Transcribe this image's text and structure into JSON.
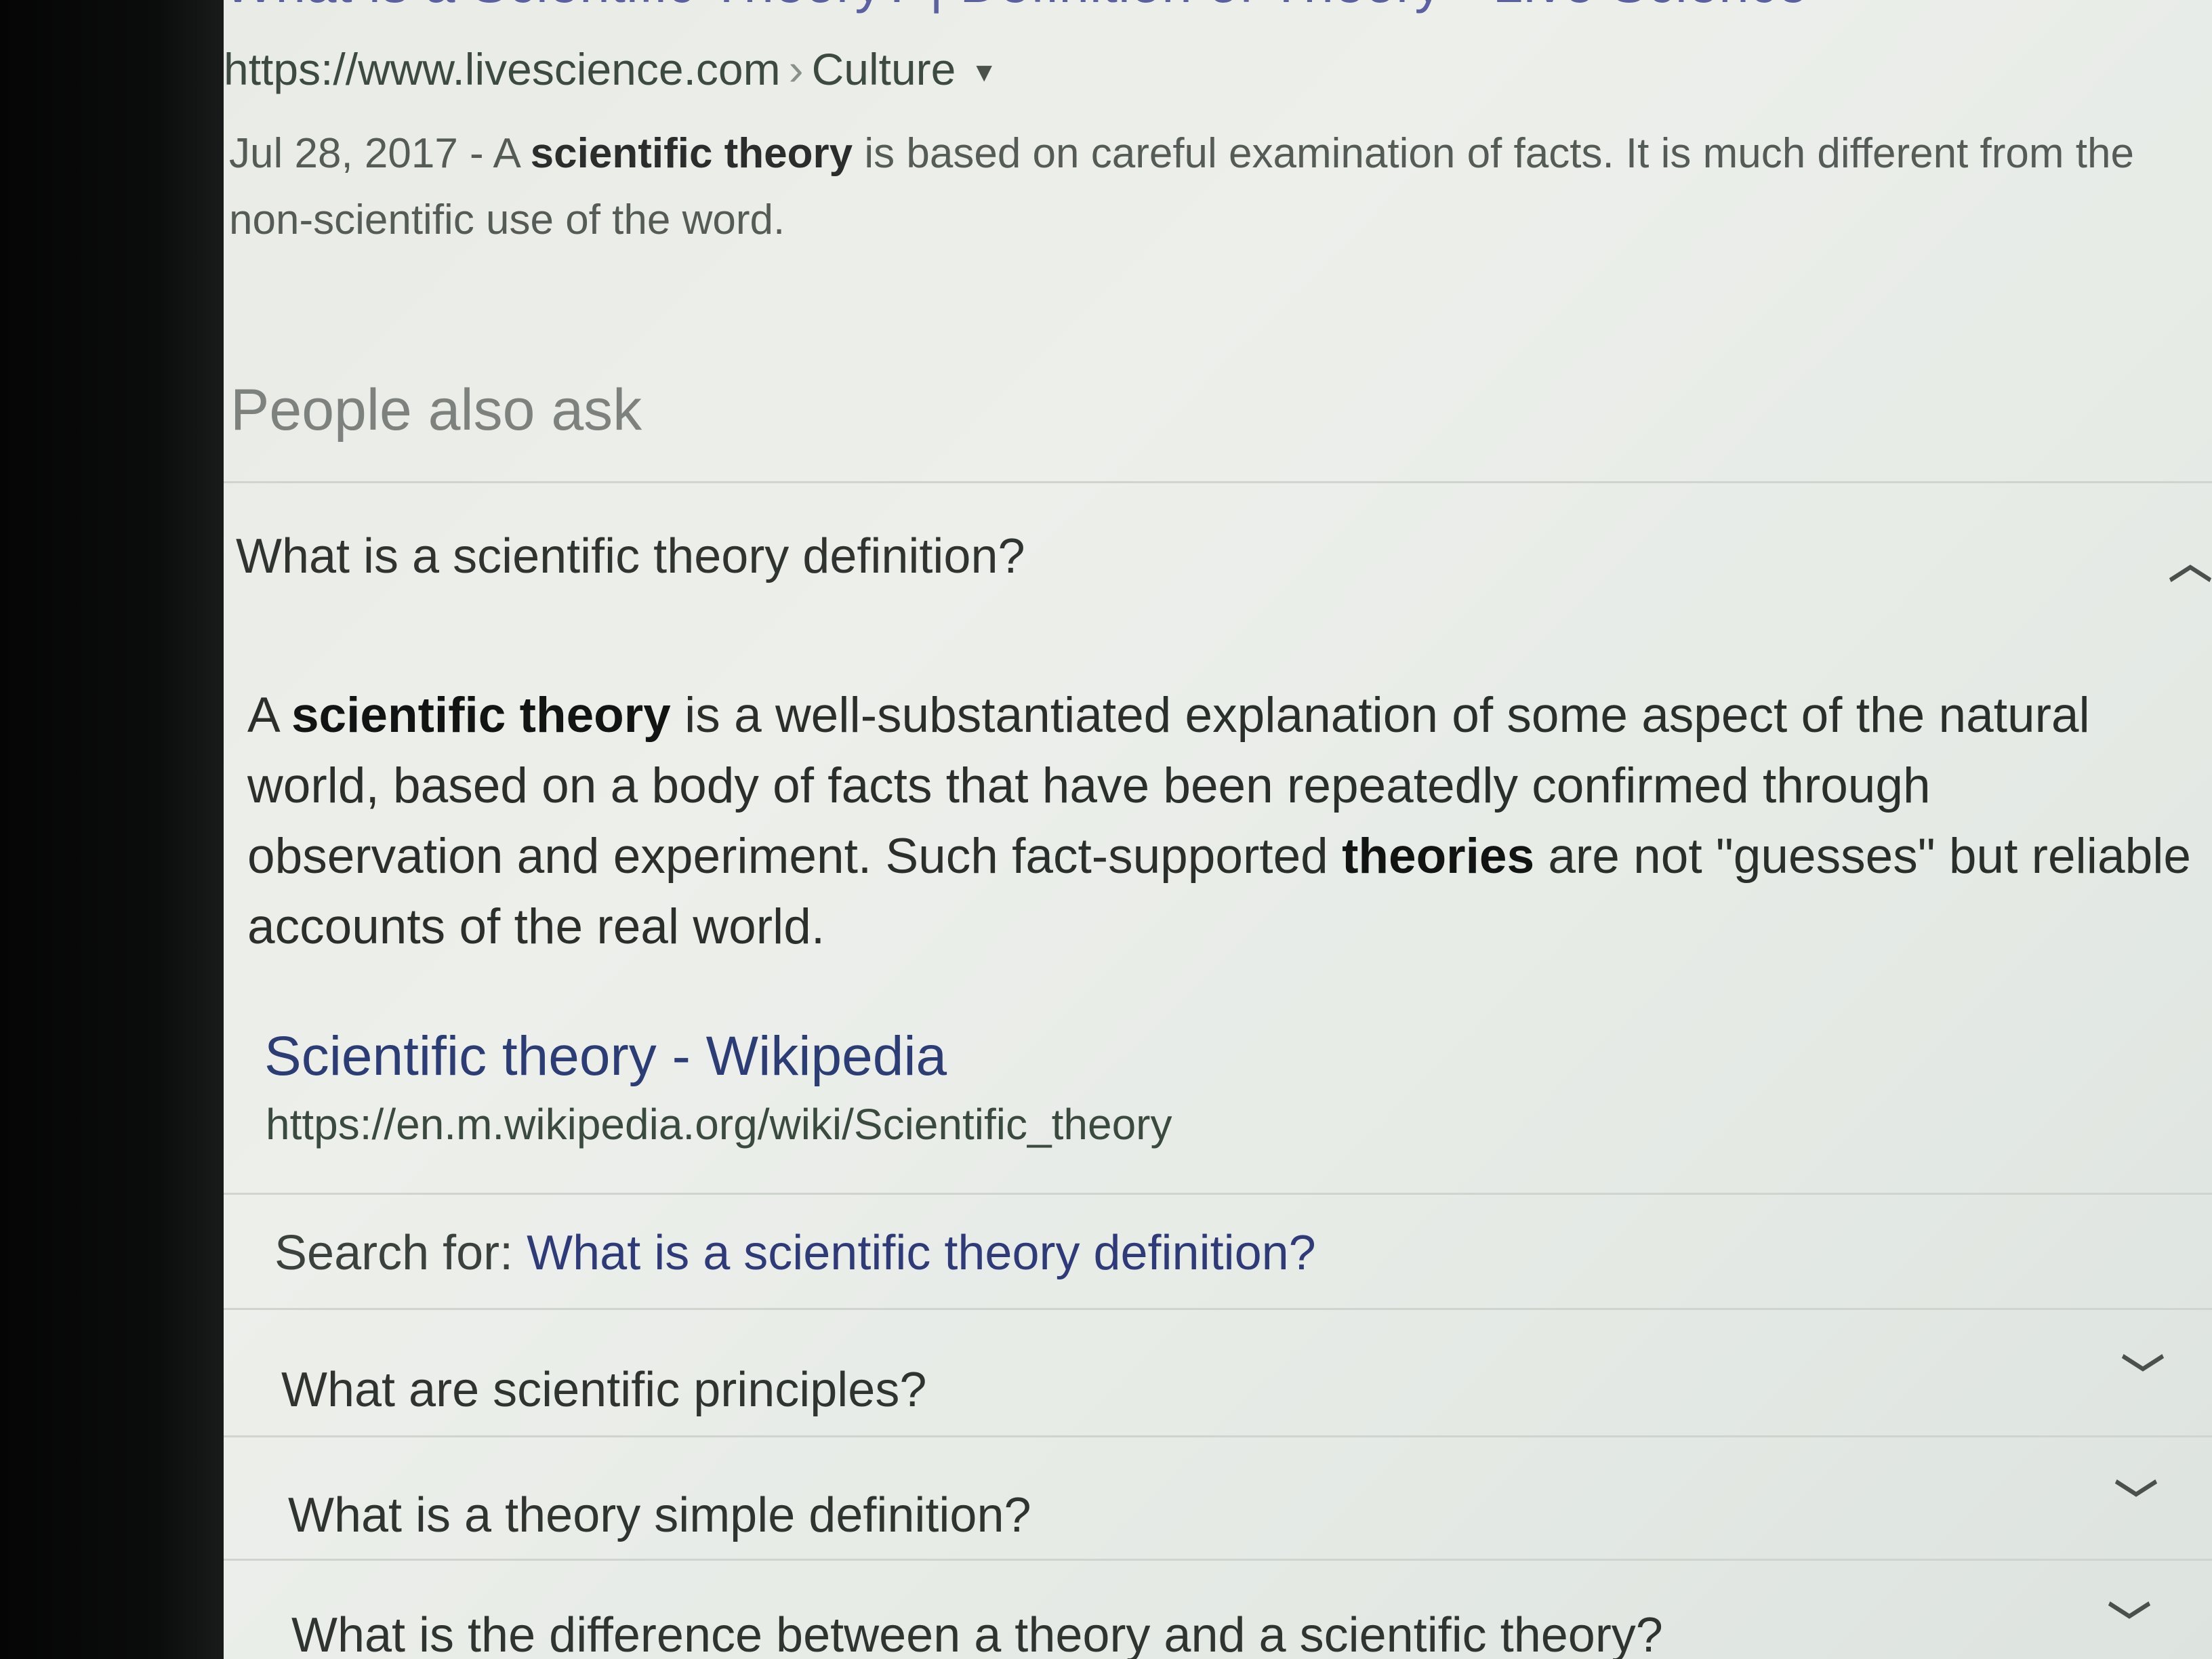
{
  "top_result": {
    "title_partial": "What is a Scientific Theory? | Definition of Theory - Live Science",
    "url": "https://www.livescience.com",
    "breadcrumb": "Culture",
    "dropdown_icon": "triangle-down-icon",
    "snippet_date": "Jul 28, 2017",
    "snippet_sep": " - A ",
    "snippet_bold": "scientific theory",
    "snippet_rest": " is based on careful examination of facts. It is much different from the non-scientific use of the word."
  },
  "people_also_ask": {
    "heading": "People also ask",
    "expanded": {
      "question": "What is a scientific theory definition?",
      "toggle_icon": "chevron-up-icon",
      "answer": {
        "p1": "A ",
        "b1": "scientific theory",
        "p2": " is a well-substantiated explanation of some aspect of the natural world, based on a body of facts that have been repeatedly confirmed through observation and experiment. Such fact-supported ",
        "b2": "theories",
        "p3": " are not \"guesses\" but reliable accounts of the real world."
      },
      "source_title": "Scientific theory - Wikipedia",
      "source_url": "https://en.m.wikipedia.org/wiki/Scientific_theory",
      "search_for_label": "Search for: ",
      "search_for_query": "What is a scientific theory definition?"
    },
    "collapsed": [
      {
        "question": "What are scientific principles?",
        "icon": "chevron-down-icon"
      },
      {
        "question": "What is a theory simple definition?",
        "icon": "chevron-down-icon"
      },
      {
        "question": "What is the difference between a theory and a scientific theory?",
        "icon": "chevron-down-icon"
      }
    ]
  }
}
